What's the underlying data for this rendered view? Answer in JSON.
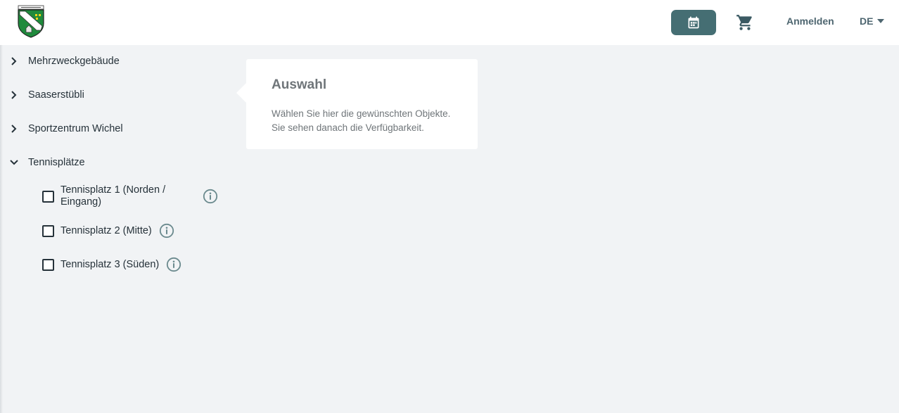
{
  "header": {
    "logo_icon": "municipal-coat-of-arms-icon",
    "calendar_icon": "calendar-icon",
    "cart_icon": "shopping-cart-icon",
    "login_label": "Anmelden",
    "language": "DE",
    "accent_color": "#456e73"
  },
  "tree": {
    "groups": [
      {
        "label": "Mehrzweckgebäude",
        "expanded": false
      },
      {
        "label": "Saaserstübli",
        "expanded": false
      },
      {
        "label": "Sportzentrum Wichel",
        "expanded": false
      },
      {
        "label": "Tennisplätze",
        "expanded": true
      }
    ],
    "tennis_items": [
      {
        "line1": "Tennisplatz 1 (Norden /",
        "line2": "Eingang)",
        "checked": false
      },
      {
        "label": "Tennisplatz 2 (Mitte)",
        "checked": false
      },
      {
        "label": "Tennisplatz 3 (Süden)",
        "checked": false
      }
    ]
  },
  "info_card": {
    "title": "Auswahl",
    "line1": "Wählen Sie hier die gewünschten Objekte.",
    "line2": "Sie sehen danach die Verfügbarkeit."
  }
}
